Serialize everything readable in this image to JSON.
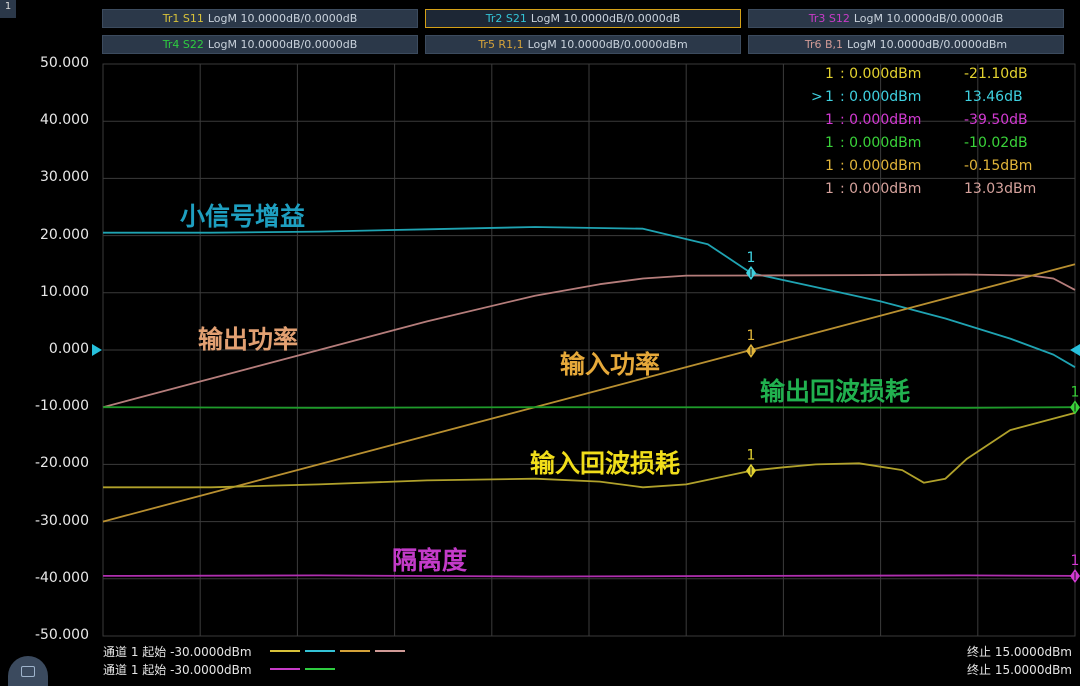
{
  "window": {
    "number": "1"
  },
  "trace_tabs": [
    {
      "name": "Tr1 S11",
      "format": "LogM 10.0000dB/0.0000dB",
      "color": "#d8c23a",
      "active": false
    },
    {
      "name": "Tr2 S21",
      "format": "LogM 10.0000dB/0.0000dB",
      "color": "#34c3d6",
      "active": true
    },
    {
      "name": "Tr3 S12",
      "format": "LogM 10.0000dB/0.0000dB",
      "color": "#c83cc8",
      "active": false
    },
    {
      "name": "Tr4 S22",
      "format": "LogM 10.0000dB/0.0000dB",
      "color": "#2ecc40",
      "active": false
    },
    {
      "name": "Tr5 R1,1",
      "format": "LogM 10.0000dB/0.0000dBm",
      "color": "#d4a23a",
      "active": false
    },
    {
      "name": "Tr6 B,1",
      "format": "LogM 10.0000dB/0.0000dBm",
      "color": "#d09a96",
      "active": false
    }
  ],
  "marker_table": [
    {
      "prefix": "",
      "id": "1",
      "stimulus": ": 0.000dBm",
      "response": "-21.10dB",
      "color": "#e3d230"
    },
    {
      "prefix": ">",
      "id": "1",
      "stimulus": ": 0.000dBm",
      "response": "13.46dB",
      "color": "#3fd1e0"
    },
    {
      "prefix": "",
      "id": "1",
      "stimulus": ": 0.000dBm",
      "response": "-39.50dB",
      "color": "#d23ad2"
    },
    {
      "prefix": "",
      "id": "1",
      "stimulus": ": 0.000dBm",
      "response": "-10.02dB",
      "color": "#3ad33a"
    },
    {
      "prefix": "",
      "id": "1",
      "stimulus": ": 0.000dBm",
      "response": "-0.15dBm",
      "color": "#e1b53a"
    },
    {
      "prefix": "",
      "id": "1",
      "stimulus": ": 0.000dBm",
      "response": "13.03dBm",
      "color": "#d6a29c"
    }
  ],
  "annotations": {
    "small_signal_gain": "小信号增益",
    "output_power": "输出功率",
    "input_power": "输入功率",
    "output_return_loss": "输出回波损耗",
    "input_return_loss": "输入回波损耗",
    "isolation": "隔离度"
  },
  "status": {
    "line1_left": "通道 1 起始 -30.0000dBm",
    "line2_left": "通道 1 起始 -30.0000dBm",
    "line1_right": "终止 15.0000dBm",
    "line2_right": "终止 15.0000dBm",
    "line1_swatches": [
      "#d8c23a",
      "#34c3d6",
      "#d4a23a",
      "#d09a96"
    ],
    "line2_swatches": [
      "#c83cc8",
      "#2ecc40"
    ]
  },
  "chart_data": {
    "type": "line",
    "x_unit": "dBm",
    "xlim": [
      -30,
      15
    ],
    "ylim": [
      -50,
      50
    ],
    "yticks": [
      "50.000",
      "40.000",
      "30.000",
      "20.000",
      "10.000",
      "0.000",
      "-10.000",
      "-20.000",
      "-30.000",
      "-40.000",
      "-50.000"
    ],
    "grid": true,
    "reference_level": 0,
    "marker_x": 0,
    "marker_label": "1",
    "series": [
      {
        "name": "Tr2 S21",
        "color": "#1fa3b2",
        "x": [
          -30,
          -25,
          -20,
          -15,
          -10,
          -5,
          -2,
          0,
          3,
          6,
          9,
          12,
          14,
          15
        ],
        "y": [
          20.5,
          20.5,
          20.7,
          21.1,
          21.5,
          21.2,
          18.5,
          13.46,
          11.0,
          8.5,
          5.5,
          2.0,
          -0.8,
          -3.0
        ]
      },
      {
        "name": "Tr6 B,1",
        "color": "#b57d7b",
        "x": [
          -30,
          -25,
          -20,
          -15,
          -10,
          -7,
          -5,
          -3,
          0,
          5,
          10,
          13,
          14,
          15
        ],
        "y": [
          -10,
          -5,
          0,
          5,
          9.5,
          11.5,
          12.5,
          13.0,
          13.03,
          13.1,
          13.2,
          13.0,
          12.5,
          10.5
        ]
      },
      {
        "name": "Tr5 R1,1",
        "color": "#b88f30",
        "x": [
          -30,
          15
        ],
        "y": [
          -30,
          15
        ]
      },
      {
        "name": "Tr4 S22",
        "color": "#1e9b2a",
        "x": [
          -30,
          -20,
          -10,
          0,
          10,
          15
        ],
        "y": [
          -10,
          -10.1,
          -10,
          -10.02,
          -10.1,
          -10
        ]
      },
      {
        "name": "Tr1 S11",
        "color": "#b0a12b",
        "x": [
          -30,
          -25,
          -20,
          -15,
          -10,
          -7,
          -5,
          -3,
          0,
          1.5,
          3,
          5,
          7,
          8,
          9,
          10,
          12,
          15
        ],
        "y": [
          -24,
          -24,
          -23.5,
          -22.8,
          -22.5,
          -23,
          -24,
          -23.5,
          -21.1,
          -20.5,
          -20,
          -19.8,
          -21,
          -23.2,
          -22.5,
          -19,
          -14,
          -11
        ]
      },
      {
        "name": "Tr3 S12",
        "color": "#b02fb0",
        "x": [
          -30,
          -20,
          -10,
          0,
          10,
          15
        ],
        "y": [
          -39.5,
          -39.4,
          -39.6,
          -39.5,
          -39.4,
          -39.5
        ]
      }
    ],
    "markers": [
      {
        "series": "Tr2 S21",
        "x": 0,
        "y": 13.46,
        "color": "#3fd1e0"
      },
      {
        "series": "Tr5 R1,1",
        "x": 0,
        "y": -0.15,
        "color": "#e1b53a"
      },
      {
        "series": "Tr1 S11",
        "x": 0,
        "y": -21.1,
        "color": "#e3d230"
      },
      {
        "series": "Tr4 S22",
        "x": 15,
        "y": -10.02,
        "color": "#3ad33a"
      },
      {
        "series": "Tr3 S12",
        "x": 15,
        "y": -39.5,
        "color": "#d23ad2"
      }
    ]
  }
}
